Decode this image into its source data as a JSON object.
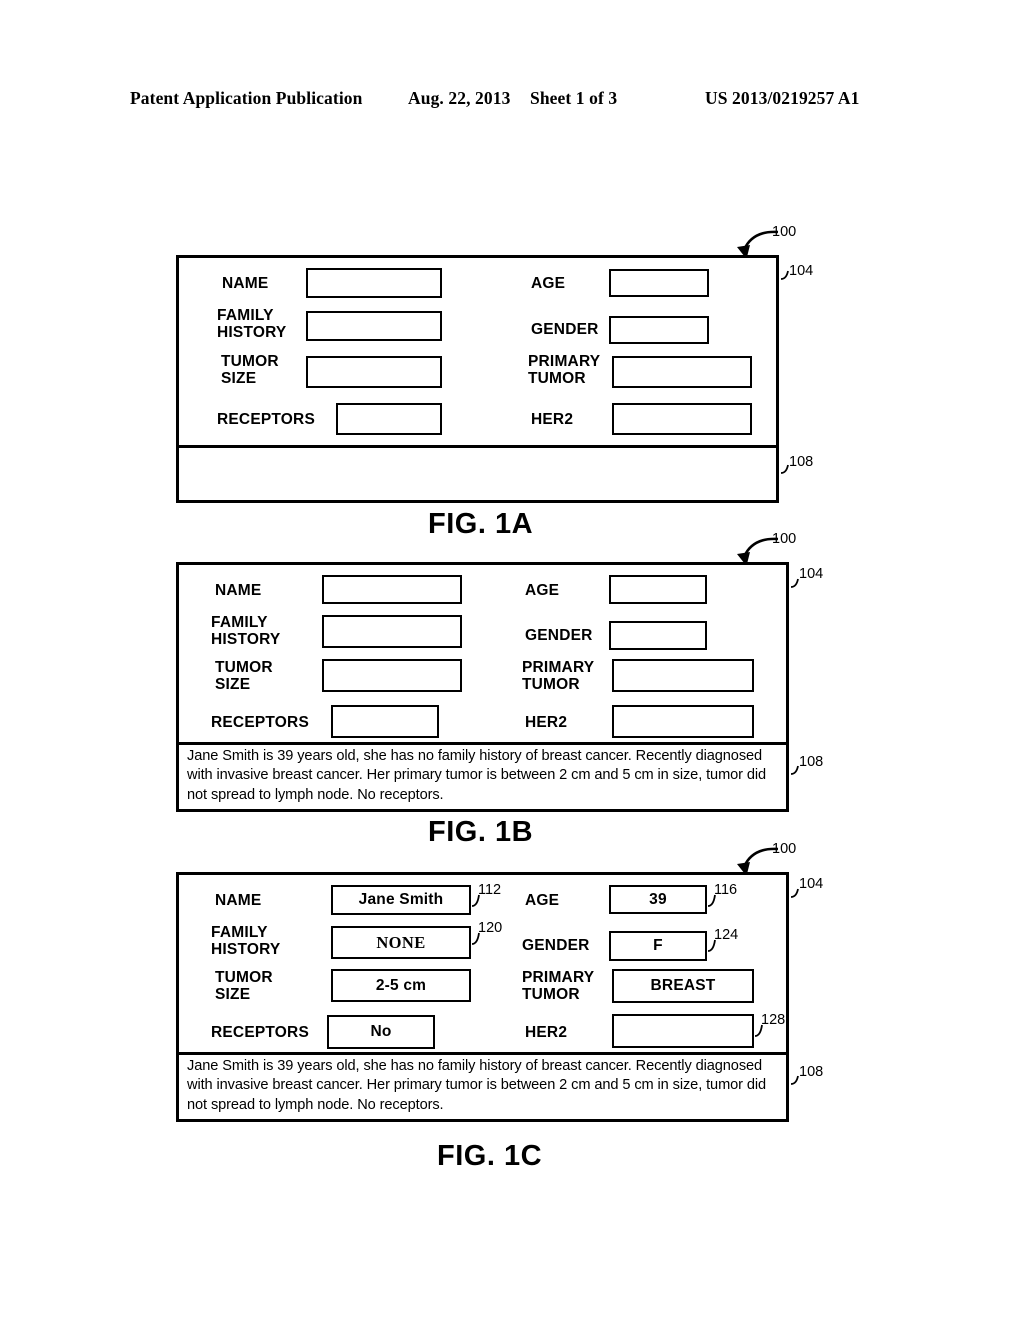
{
  "header": {
    "publication": "Patent Application Publication",
    "date": "Aug. 22, 2013",
    "sheet": "Sheet 1 of 3",
    "patent_number": "US 2013/0219257 A1"
  },
  "labels": {
    "name": "NAME",
    "family_history": "FAMILY\nHISTORY",
    "tumor_size": "TUMOR\nSIZE",
    "receptors": "RECEPTORS",
    "age": "AGE",
    "gender": "GENDER",
    "primary_tumor": "PRIMARY\nTUMOR",
    "her2": "HER2"
  },
  "refs": {
    "record": "100",
    "form_area": "104",
    "desc_area": "108",
    "name_field": "112",
    "age_field": "116",
    "family_history_field": "120",
    "gender_field": "124",
    "her2_field": "128"
  },
  "description_text": "Jane Smith is 39 years old, she has no family history of breast cancer. Recently diagnosed with invasive breast cancer. Her primary tumor is between 2 cm and 5 cm in size, tumor did not spread to lymph node. No receptors.",
  "figures": [
    {
      "id": "fig1a",
      "caption": "FIG. 1A",
      "values": {
        "name": "",
        "family_history": "",
        "tumor_size": "",
        "receptors": "",
        "age": "",
        "gender": "",
        "primary_tumor": "",
        "her2": ""
      },
      "description": "",
      "shown_refs": [
        "100",
        "104",
        "108"
      ]
    },
    {
      "id": "fig1b",
      "caption": "FIG. 1B",
      "values": {
        "name": "",
        "family_history": "",
        "tumor_size": "",
        "receptors": "",
        "age": "",
        "gender": "",
        "primary_tumor": "",
        "her2": ""
      },
      "description": "Jane Smith is 39 years old, she has no family history of breast cancer. Recently diagnosed with invasive breast cancer. Her primary tumor is between 2 cm and 5 cm in size, tumor did not spread to lymph node. No receptors.",
      "shown_refs": [
        "100",
        "104",
        "108"
      ]
    },
    {
      "id": "fig1c",
      "caption": "FIG. 1C",
      "values": {
        "name": "Jane Smith",
        "family_history": "NONE",
        "tumor_size": "2-5 cm",
        "receptors": "No",
        "age": "39",
        "gender": "F",
        "primary_tumor": "BREAST",
        "her2": ""
      },
      "description": "Jane Smith is 39 years old, she has no family history of breast cancer. Recently diagnosed with invasive breast cancer. Her primary tumor is between 2 cm and 5 cm in size, tumor did not spread to lymph node. No receptors.",
      "shown_refs": [
        "100",
        "104",
        "108",
        "112",
        "116",
        "120",
        "124",
        "128"
      ]
    }
  ]
}
